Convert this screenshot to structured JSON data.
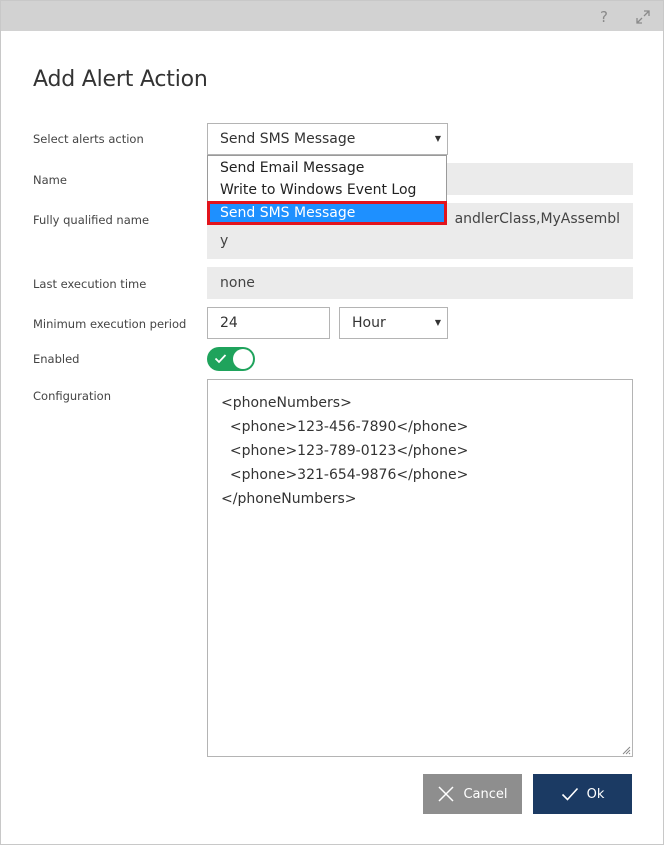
{
  "titlebar": {
    "help_label": "?"
  },
  "dialog": {
    "title": "Add Alert Action"
  },
  "form": {
    "select_action": {
      "label": "Select alerts action",
      "value": "Send SMS Message",
      "options": [
        "Send Email Message",
        "Write to Windows Event Log",
        "Send SMS Message"
      ],
      "highlighted": "Send SMS Message"
    },
    "name": {
      "label": "Name",
      "value": ""
    },
    "fqn": {
      "label": "Fully qualified name",
      "value_line1": "andlerClass,MyAssembl",
      "value_line2": "y"
    },
    "last_execution": {
      "label": "Last execution time",
      "value": "none"
    },
    "min_period": {
      "label": "Minimum execution period",
      "value": "24",
      "unit": "Hour"
    },
    "enabled": {
      "label": "Enabled",
      "value": true
    },
    "configuration": {
      "label": "Configuration",
      "lines": [
        "<phoneNumbers>",
        "  <phone>123-456-7890</phone>",
        "  <phone>123-789-0123</phone>",
        "  <phone>321-654-9876</phone>",
        "</phoneNumbers>"
      ]
    }
  },
  "buttons": {
    "cancel": "Cancel",
    "ok": "Ok"
  },
  "colors": {
    "primary": "#1b3a63",
    "secondary": "#8e8e8e",
    "toggle_on": "#1fa35c",
    "highlight": "#1e90ff",
    "highlight_border": "#e2141c"
  },
  "icons": {
    "help": "question-mark-icon",
    "expand": "expand-icon",
    "cancel": "close-icon",
    "ok": "checkmark-icon",
    "toggle": "checkmark-icon"
  }
}
